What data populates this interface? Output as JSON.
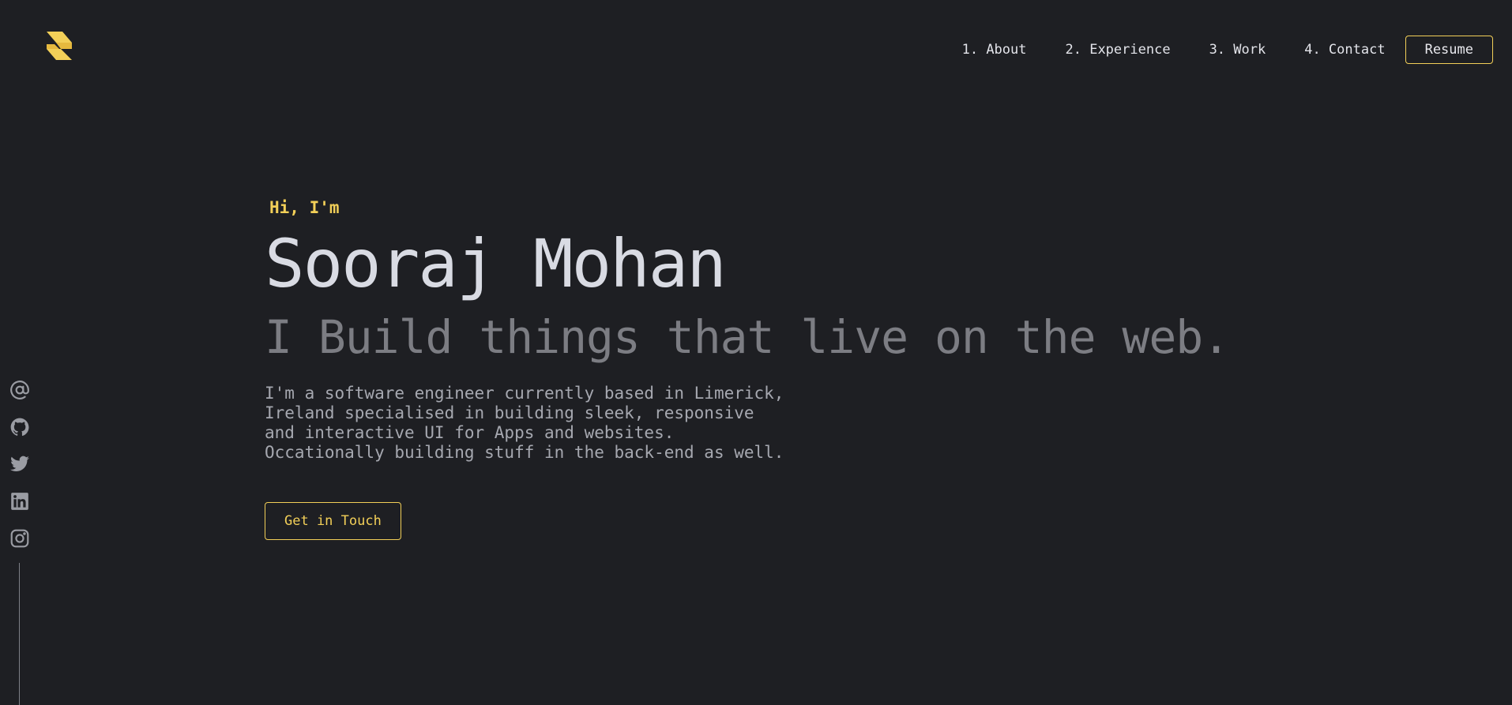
{
  "colors": {
    "background": "#1e1f23",
    "accent": "#f2cf58",
    "heading": "#d9dbe3",
    "tagline": "#7c7d83",
    "body_text": "#a6a8b0",
    "icon": "#9a9ca3"
  },
  "header": {
    "logo_icon": "s-logo-icon",
    "nav": [
      {
        "label": "1. About"
      },
      {
        "label": "2. Experience"
      },
      {
        "label": "3. Work"
      },
      {
        "label": "4. Contact"
      }
    ],
    "resume_label": "Resume"
  },
  "social": {
    "icons": [
      "at-email-icon",
      "github-icon",
      "twitter-icon",
      "linkedin-icon",
      "instagram-icon"
    ]
  },
  "hero": {
    "greeting": "Hi, I'm",
    "name": "Sooraj Mohan",
    "tagline": "I Build things that live on the web.",
    "bio_lines": [
      "I'm a software engineer currently based in Limerick,",
      "Ireland specialised in building sleek, responsive",
      "and interactive UI for Apps and websites.",
      "Occationally building stuff in the back-end as well."
    ],
    "cta_label": "Get in Touch"
  }
}
